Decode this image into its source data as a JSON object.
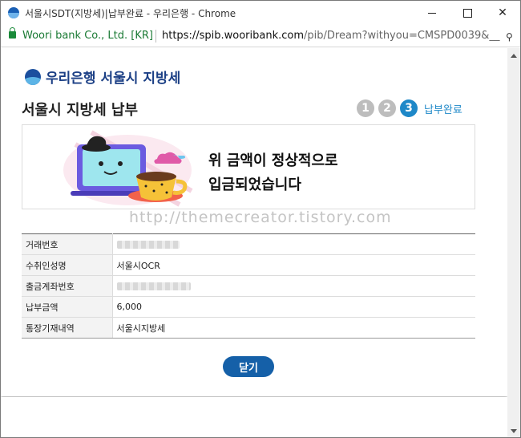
{
  "window": {
    "title": "서울시SDT(지방세)|납부완료 - 우리은행 - Chrome"
  },
  "address_bar": {
    "cert": "Woori bank Co., Ltd. [KR]",
    "url_host": "https://spib.wooribank.com",
    "url_rest": "/pib/Dream?withyou=CMSPD0039&__"
  },
  "header": {
    "brand": "우리은행 서울시 지방세"
  },
  "page": {
    "title": "서울시 지방세 납부",
    "steps": [
      "1",
      "2",
      "3"
    ],
    "active_step_label": "납부완료"
  },
  "banner": {
    "line1": "위 금액이 정상적으로",
    "line2": "입금되었습니다"
  },
  "watermark": "http://themecreator.tistory.com",
  "table": {
    "rows": [
      {
        "label": "거래번호",
        "value": ""
      },
      {
        "label": "수취인성명",
        "value": "서울시OCR"
      },
      {
        "label": "출금계좌번호",
        "value": ""
      },
      {
        "label": "납부금액",
        "value": "6,000"
      },
      {
        "label": "통장기재내역",
        "value": "서울시지방세"
      }
    ]
  },
  "buttons": {
    "close": "닫기"
  },
  "colors": {
    "accent": "#1e88c8",
    "button": "#1560a8",
    "brand": "#1b3f85"
  }
}
